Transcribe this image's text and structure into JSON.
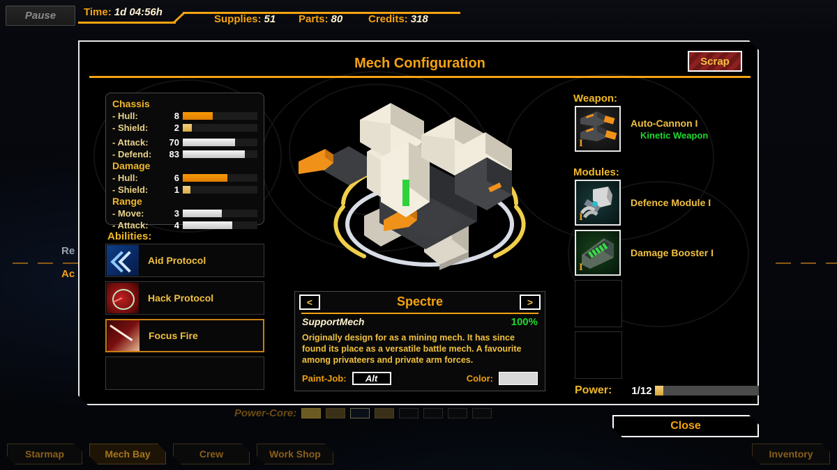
{
  "topbar": {
    "pause_label": "Pause",
    "time_label": "Time:",
    "time_value": "1d 04:56h",
    "supplies_label": "Supplies:",
    "supplies_value": "51",
    "parts_label": "Parts:",
    "parts_value": "80",
    "credits_label": "Credits:",
    "credits_value": "318",
    "accent_color": "#f5a310"
  },
  "background": {
    "research_label": "Re",
    "active_label": "Ac",
    "powercore_label": "Power-Core:"
  },
  "dialog": {
    "title": "Mech Configuration",
    "scrap_label": "Scrap",
    "close_label": "Close"
  },
  "stats": {
    "groups": [
      {
        "name": "Chassis",
        "rows": [
          {
            "label": "- Hull:",
            "value": "8",
            "pct": 40,
            "bar": "orange"
          },
          {
            "label": "- Shield:",
            "value": "2",
            "pct": 12,
            "bar": "gold"
          },
          {
            "label": "- Attack:",
            "value": "70",
            "pct": 70,
            "bar": "white"
          },
          {
            "label": "- Defend:",
            "value": "83",
            "pct": 83,
            "bar": "white"
          }
        ]
      },
      {
        "name": "Damage",
        "rows": [
          {
            "label": "- Hull:",
            "value": "6",
            "pct": 60,
            "bar": "orange"
          },
          {
            "label": "- Shield:",
            "value": "1",
            "pct": 10,
            "bar": "gold"
          }
        ]
      },
      {
        "name": "Range",
        "rows": [
          {
            "label": "- Move:",
            "value": "3",
            "pct": 52,
            "bar": "white"
          },
          {
            "label": "- Attack:",
            "value": "4",
            "pct": 66,
            "bar": "white"
          }
        ]
      }
    ]
  },
  "abilities": {
    "label": "Abilities:",
    "items": [
      {
        "name": "Aid Protocol",
        "icon": "aid-chevron-icon",
        "selected": false
      },
      {
        "name": "Hack Protocol",
        "icon": "hack-gauge-icon",
        "selected": false
      },
      {
        "name": "Focus Fire",
        "icon": "focus-beam-icon",
        "selected": true
      },
      {
        "name": "",
        "icon": "empty-slot-icon",
        "selected": false
      }
    ]
  },
  "mech_info": {
    "prev_label": "<",
    "next_label": ">",
    "name": "Spectre",
    "class": "SupportMech",
    "condition": "100%",
    "description": "Originally design for as a mining mech. It has since found its place as a versatile battle mech. A favourite among privateers and private arm forces.",
    "paint_label": "Paint-Job:",
    "paint_value": "Alt",
    "color_label": "Color:",
    "color_value": "#d8d8d8"
  },
  "equipment": {
    "weapon_label": "Weapon:",
    "weapon": {
      "name": "Auto-Cannon I",
      "type": "Kinetic Weapon",
      "tier": "I",
      "icon": "auto-cannon-icon"
    },
    "modules_label": "Modules:",
    "modules": [
      {
        "name": "Defence Module I",
        "tier": "I",
        "icon": "defence-module-icon"
      },
      {
        "name": "Damage Booster I",
        "tier": "I",
        "icon": "damage-booster-icon"
      }
    ],
    "empty_module_slots": 2
  },
  "power": {
    "label": "Power:",
    "value": "1/12",
    "pct": 8
  },
  "bottomnav": {
    "items": [
      {
        "label": "Starmap",
        "active": false
      },
      {
        "label": "Mech Bay",
        "active": true
      },
      {
        "label": "Crew",
        "active": false
      },
      {
        "label": "Work Shop",
        "active": false
      }
    ],
    "inventory_label": "Inventory"
  }
}
